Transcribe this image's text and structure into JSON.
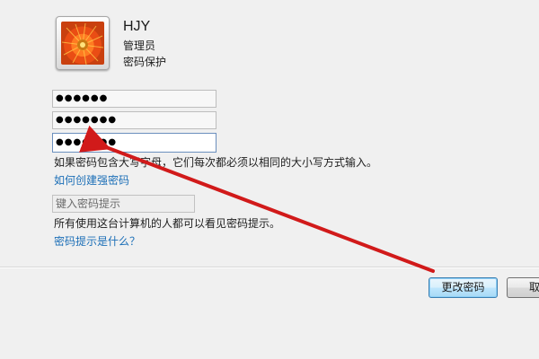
{
  "user": {
    "name": "HJY",
    "role": "管理员",
    "protection": "密码保护"
  },
  "fields": {
    "current_password": "●●●●●●",
    "new_password": "●●●●●●●",
    "confirm_password": "●●●●●●●",
    "hint_placeholder": "键入密码提示"
  },
  "notes": {
    "case_sensitive": "如果密码包含大写字母，它们每次都必须以相同的大小写方式输入。",
    "hint_visible": "所有使用这台计算机的人都可以看见密码提示。"
  },
  "links": {
    "strong_password": "如何创建强密码",
    "what_is_hint": "密码提示是什么？"
  },
  "buttons": {
    "change_password": "更改密码",
    "cancel": "取"
  },
  "colors": {
    "background": "#f0f0f0",
    "link": "#1c6fb7",
    "annotation_arrow": "#d11a1a"
  },
  "icons": {
    "avatar": "orange-flower-avatar-icon"
  }
}
